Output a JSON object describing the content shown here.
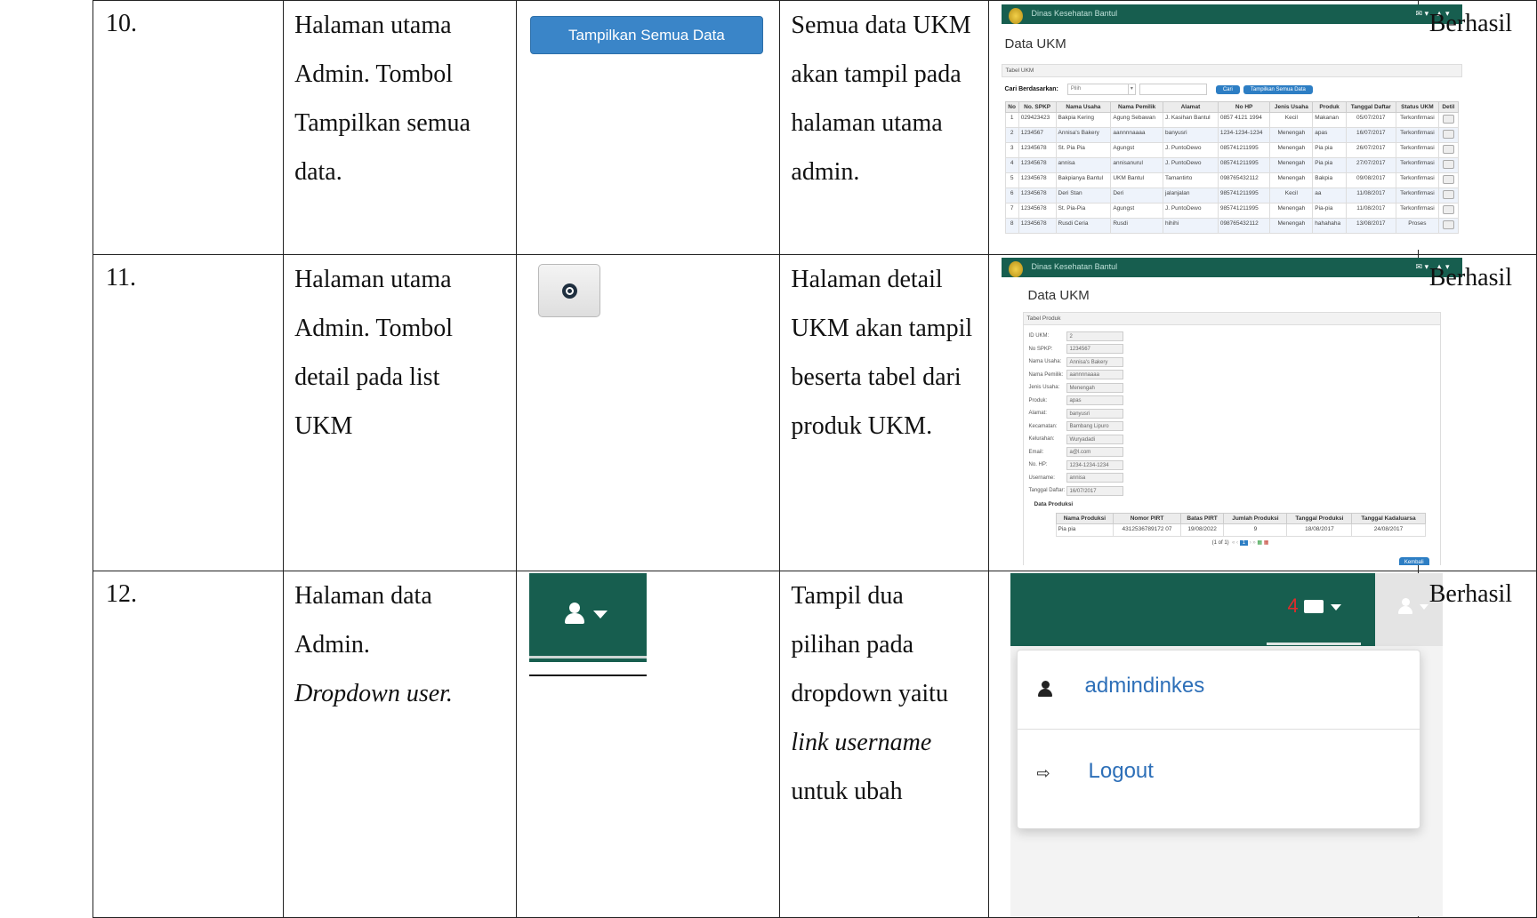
{
  "rows": [
    {
      "no": "10.",
      "scenario": [
        "Halaman utama",
        "Admin. Tombol",
        "Tampilkan semua",
        "data."
      ],
      "button_label": "Tampilkan Semua Data",
      "expected": [
        "Semua data UKM",
        "akan tampil pada",
        "halaman utama",
        "admin."
      ],
      "status": "Berhasil",
      "screenshot": {
        "app_title": "Dinas Kesehatan Bantul",
        "page_title": "Data UKM",
        "panel_title": "Tabel UKM",
        "search_label": "Cari Berdasarkan:",
        "search_select": "Pilih",
        "cari_button": "Cari",
        "show_all_button": "Tampilkan Semua Data",
        "columns": [
          "No",
          "No. SPKP",
          "Nama Usaha",
          "Nama Pemilik",
          "Alamat",
          "No HP",
          "Jenis Usaha",
          "Produk",
          "Tanggal Daftar",
          "Status UKM",
          "Detil"
        ],
        "table_rows": [
          [
            "1",
            "029423423",
            "Bakpia Kering",
            "Agung Sebawan",
            "J. Kasihan Bantul",
            "0857 4121 1994",
            "Kecil",
            "Makanan",
            "05/07/2017",
            "Terkonfirmasi"
          ],
          [
            "2",
            "1234567",
            "Annisa's Bakery",
            "aannnnaaaa",
            "banyusri",
            "1234-1234-1234",
            "Menengah",
            "apas",
            "16/07/2017",
            "Terkonfirmasi"
          ],
          [
            "3",
            "12345678",
            "St. Pia Pia",
            "Agungst",
            "J. PuntoDewo",
            "085741211995",
            "Menengah",
            "Pia pia",
            "26/07/2017",
            "Terkonfirmasi"
          ],
          [
            "4",
            "12345678",
            "annisa",
            "annisanurul",
            "J. PuntoDewo",
            "085741211995",
            "Menengah",
            "Pia pia",
            "27/07/2017",
            "Terkonfirmasi"
          ],
          [
            "5",
            "12345678",
            "Bakpianya Bantul",
            "UKM Bantul",
            "Tamantirto",
            "098765432112",
            "Menengah",
            "Bakpia",
            "09/08/2017",
            "Terkonfirmasi"
          ],
          [
            "6",
            "12345678",
            "Deri Stan",
            "Deri",
            "jalanjalan",
            "985741211995",
            "Kecil",
            "aa",
            "11/08/2017",
            "Terkonfirmasi"
          ],
          [
            "7",
            "12345678",
            "St. Pia-Pia",
            "Agungst",
            "J. PuntoDewo",
            "985741211995",
            "Menengah",
            "Pia-pia",
            "11/08/2017",
            "Terkonfirmasi"
          ],
          [
            "8",
            "12345678",
            "Rusdi Ceria",
            "Rusdi",
            "hihihi",
            "098765432112",
            "Menengah",
            "hahahaha",
            "13/08/2017",
            "Proses"
          ]
        ]
      }
    },
    {
      "no": "11.",
      "scenario": [
        "Halaman utama",
        "Admin. Tombol",
        "detail pada list",
        "UKM"
      ],
      "button_icon": "search-icon",
      "expected": [
        "Halaman detail",
        "UKM akan tampil",
        "beserta tabel dari",
        "produk UKM."
      ],
      "status": "Berhasil",
      "screenshot": {
        "app_title": "Dinas Kesehatan Bantul",
        "page_title": "Data UKM",
        "panel_title": "Tabel Produk",
        "fields": [
          {
            "label": "ID UKM:",
            "value": "2"
          },
          {
            "label": "No SPKP:",
            "value": "1234567"
          },
          {
            "label": "Nama Usaha:",
            "value": "Annisa's Bakery"
          },
          {
            "label": "Nama Pemilik:",
            "value": "aannnnaaaa"
          },
          {
            "label": "Jenis Usaha:",
            "value": "Menengah"
          },
          {
            "label": "Produk:",
            "value": "apas"
          },
          {
            "label": "Alamat:",
            "value": "banyusri"
          },
          {
            "label": "Kecamatan:",
            "value": "Bambang Lipuro"
          },
          {
            "label": "Kelurahan:",
            "value": "Wuryadadi"
          },
          {
            "label": "Email:",
            "value": "a@l.com"
          },
          {
            "label": "No. HP:",
            "value": "1234-1234-1234"
          },
          {
            "label": "Username:",
            "value": "annisa"
          },
          {
            "label": "Tanggal Daftar:",
            "value": "16/07/2017"
          }
        ],
        "produksi_title": "Data Produksi",
        "produksi_columns": [
          "Nama Produksi",
          "Nomor PIRT",
          "Batas PIRT",
          "Jumlah Produksi",
          "Tanggal Produksi",
          "Tanggal Kadaluarsa"
        ],
        "produksi_rows": [
          [
            "Pia pia",
            "4312536789172 07",
            "19/08/2022",
            "9",
            "18/08/2017",
            "24/08/2017"
          ]
        ],
        "pager": "(1 of 1)",
        "kembali_button": "Kembali"
      }
    },
    {
      "no": "12.",
      "scenario": [
        "Halaman data",
        "Admin."
      ],
      "scenario_italic": "Dropdown user.",
      "button_icon": "user-icon",
      "expected": [
        "Tampil dua",
        "pilihan pada",
        "dropdown yaitu"
      ],
      "expected_italic": "link username",
      "expected_tail": "untuk ubah",
      "status": "Berhasil",
      "screenshot": {
        "mail_count": "4",
        "menu_items": [
          {
            "icon": "user-icon",
            "label": "admindinkes"
          },
          {
            "icon": "sign-out-icon",
            "label": "Logout"
          }
        ]
      }
    }
  ]
}
